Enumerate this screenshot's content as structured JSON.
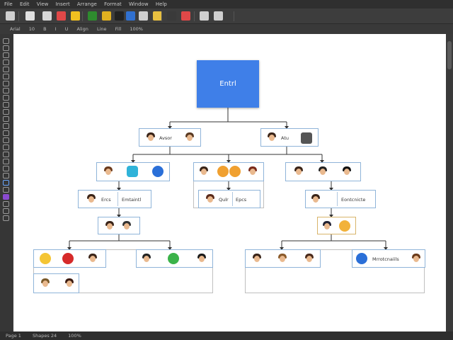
{
  "menu": [
    "File",
    "Edit",
    "View",
    "Insert",
    "Arrange",
    "Format",
    "Window",
    "Help"
  ],
  "toolbar_colors": [
    "#cfcfcf",
    "#e0e0e0",
    "#d6d6d6",
    "#e04848",
    "#f0c020",
    "#2e8b2e",
    "#e0b020",
    "#222222",
    "#3070d0",
    "#cfcfcf",
    "#e8c040",
    "#3a3a3a",
    "#e04848",
    "#d0d0d0",
    "#cfcfcf"
  ],
  "subbar": [
    "Arial",
    "10",
    "B",
    "I",
    "U",
    "Align",
    "Line",
    "Fill",
    "100%"
  ],
  "status": [
    "Page 1",
    "Shapes 24",
    "100%"
  ],
  "root": {
    "label": "Entrl"
  },
  "nodes": {
    "l1_left": [
      "Avsor",
      ""
    ],
    "l1_right": [
      "Atu",
      ""
    ],
    "l3_mid": [
      "Qulr",
      "Epcs"
    ],
    "l3_left": [
      "Ercs",
      "Emtaintl"
    ],
    "l3_right": [
      "",
      "Eontcnicte"
    ],
    "l5_right": [
      "",
      "Mrrotcnaiils"
    ]
  },
  "colors": {
    "accent": "#3f7fe8",
    "node_border": "#8fb4d9",
    "group_border": "#bfbfbf",
    "connector": "#333333"
  }
}
